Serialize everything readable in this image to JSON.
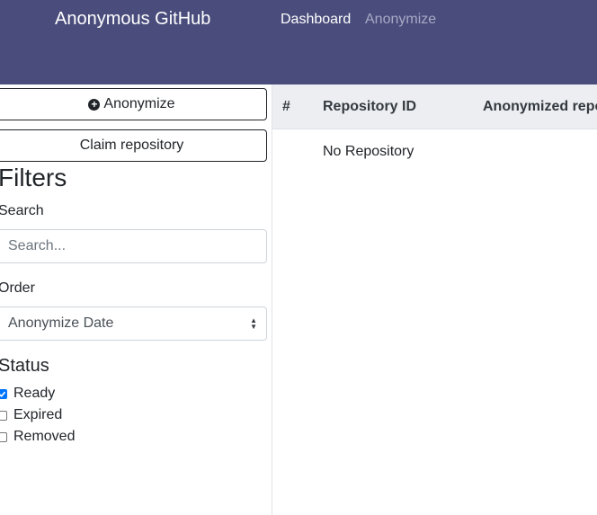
{
  "navbar": {
    "brand": "Anonymous GitHub",
    "links": [
      {
        "label": "Dashboard",
        "active": true
      },
      {
        "label": "Anonymize",
        "active": false
      }
    ],
    "bg_color": "#4a4d7c"
  },
  "sidebar": {
    "anonymize_button": {
      "label": "Anonymize",
      "icon": "plus-circle-icon"
    },
    "claim_button": {
      "label": "Claim repository"
    },
    "filters_title": "Filters",
    "search": {
      "label": "Search",
      "placeholder": "Search...",
      "value": ""
    },
    "order": {
      "label": "Order",
      "selected": "Anonymize Date"
    },
    "status": {
      "title": "Status",
      "options": [
        {
          "label": "Ready",
          "checked": true
        },
        {
          "label": "Expired",
          "checked": false
        },
        {
          "label": "Removed",
          "checked": false
        }
      ]
    }
  },
  "table": {
    "columns": [
      "#",
      "Repository ID",
      "Anonymized repo"
    ],
    "empty_message": "No Repository"
  }
}
